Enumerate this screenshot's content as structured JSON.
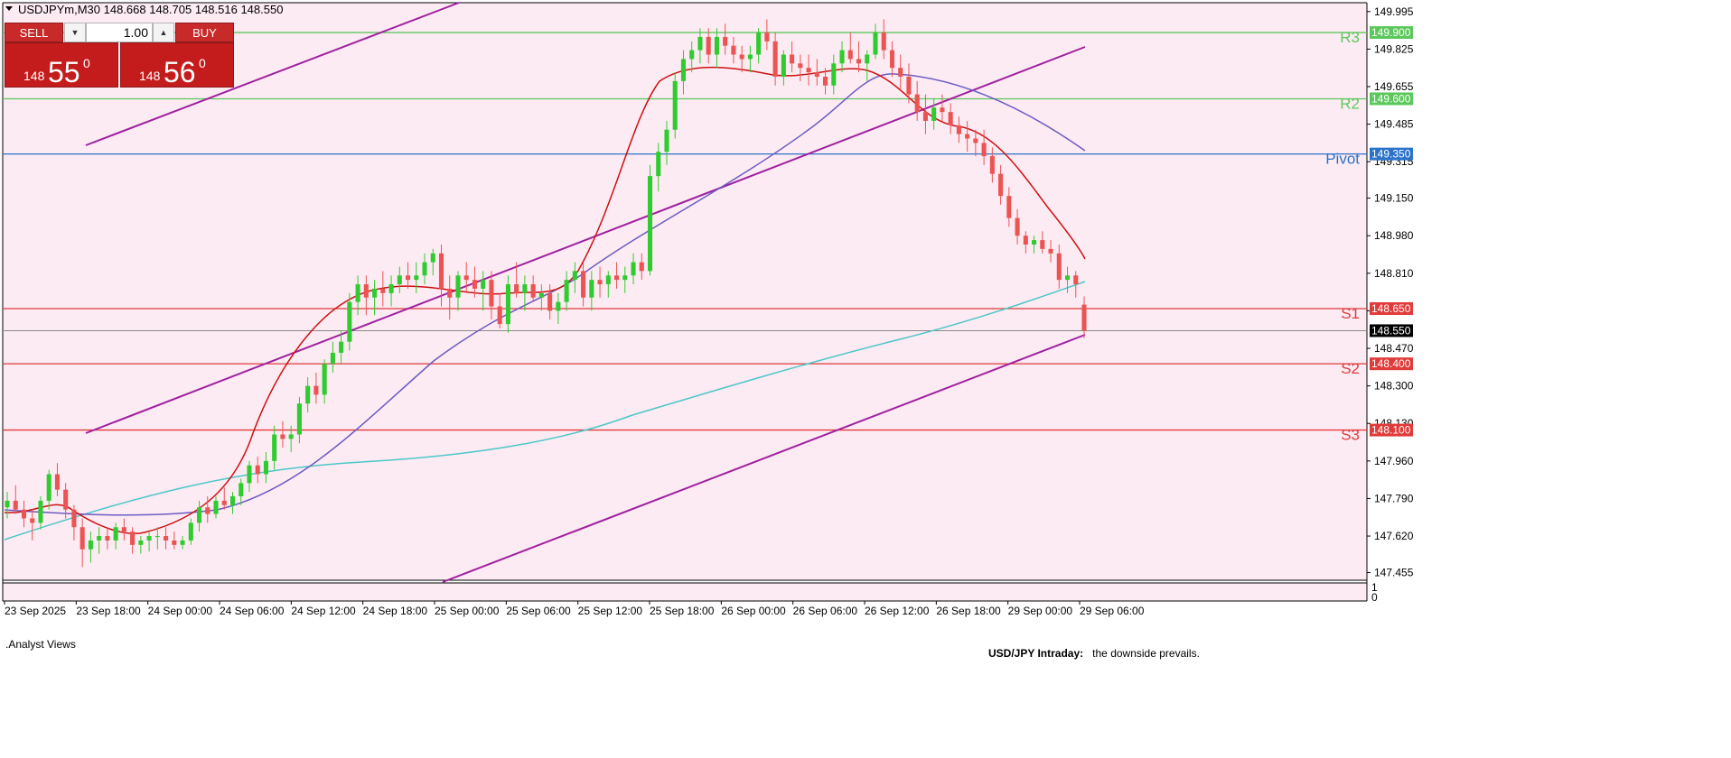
{
  "title": "USDJPYm,M30  148.668 148.705 148.516 148.550",
  "trade_panel": {
    "sell_label": "SELL",
    "buy_label": "BUY",
    "lot": "1.00",
    "sell_price_small": "148",
    "sell_price_big": "55",
    "sell_price_sup": "0",
    "buy_price_small": "148",
    "buy_price_big": "56",
    "buy_price_sup": "0"
  },
  "indicator_window": {
    "name": ".Analyst Views",
    "note_bold": "USD/JPY Intraday:",
    "note_text": "the downside prevails.",
    "scale_top": "1",
    "scale_bottom": "0"
  },
  "chart_data": {
    "type": "candlestick",
    "symbol": "USDJPYm",
    "timeframe": "M30",
    "ohlc": {
      "open": 148.668,
      "high": 148.705,
      "low": 148.516,
      "close": 148.55
    },
    "y_ticks": [
      "149.995",
      "149.825",
      "149.655",
      "149.485",
      "149.315",
      "149.150",
      "148.980",
      "148.810",
      "148.640",
      "148.470",
      "148.300",
      "148.130",
      "147.960",
      "147.790",
      "147.620",
      "147.455"
    ],
    "ylim": [
      147.42,
      150.035
    ],
    "x_labels": [
      "23 Sep 2025",
      "23 Sep 18:00",
      "24 Sep 00:00",
      "24 Sep 06:00",
      "24 Sep 12:00",
      "24 Sep 18:00",
      "25 Sep 00:00",
      "25 Sep 06:00",
      "25 Sep 12:00",
      "25 Sep 18:00",
      "26 Sep 00:00",
      "26 Sep 06:00",
      "26 Sep 12:00",
      "26 Sep 18:00",
      "29 Sep 00:00",
      "29 Sep 06:00"
    ],
    "levels": [
      {
        "name": "R3",
        "value": 149.9,
        "tag": "149.900",
        "color": "#5cc85c"
      },
      {
        "name": "R2",
        "value": 149.6,
        "tag": "149.600",
        "color": "#5cc85c"
      },
      {
        "name": "Pivot",
        "value": 149.35,
        "tag": "149.350",
        "color": "#2b72c9"
      },
      {
        "name": "S1",
        "value": 148.65,
        "tag": "148.650",
        "color": "#e03a3a"
      },
      {
        "name": "S2",
        "value": 148.4,
        "tag": "148.400",
        "color": "#e03a3a"
      },
      {
        "name": "S3",
        "value": 148.1,
        "tag": "148.100",
        "color": "#e03a3a"
      }
    ],
    "current_price": {
      "value": 148.55,
      "tag": "148.550"
    },
    "colors": {
      "bull": "#2ecc2e",
      "bear": "#ec5353",
      "ma_fast": "#cc1111",
      "ma_mid": "#6b5bc2",
      "ma_slow": "#4cc7c7",
      "channel": "#a020a0",
      "background": "#fdebf3"
    },
    "candles": [
      [
        147.75,
        147.82,
        147.7,
        147.78
      ],
      [
        147.78,
        147.85,
        147.72,
        147.74
      ],
      [
        147.74,
        147.78,
        147.66,
        147.7
      ],
      [
        147.7,
        147.74,
        147.6,
        147.68
      ],
      [
        147.68,
        147.8,
        147.65,
        147.78
      ],
      [
        147.78,
        147.92,
        147.74,
        147.9
      ],
      [
        147.9,
        147.95,
        147.8,
        147.83
      ],
      [
        147.83,
        147.86,
        147.7,
        147.74
      ],
      [
        147.74,
        147.76,
        147.6,
        147.66
      ],
      [
        147.66,
        147.7,
        147.48,
        147.56
      ],
      [
        147.56,
        147.64,
        147.5,
        147.6
      ],
      [
        147.6,
        147.66,
        147.54,
        147.62
      ],
      [
        147.62,
        147.66,
        147.56,
        147.6
      ],
      [
        147.6,
        147.68,
        147.56,
        147.66
      ],
      [
        147.66,
        147.7,
        147.6,
        147.64
      ],
      [
        147.64,
        147.66,
        147.54,
        147.58
      ],
      [
        147.58,
        147.62,
        147.54,
        147.6
      ],
      [
        147.6,
        147.64,
        147.55,
        147.62
      ],
      [
        147.62,
        147.66,
        147.56,
        147.62
      ],
      [
        147.62,
        147.66,
        147.56,
        147.6
      ],
      [
        147.6,
        147.64,
        147.56,
        147.58
      ],
      [
        147.58,
        147.62,
        147.56,
        147.6
      ],
      [
        147.6,
        147.7,
        147.58,
        147.68
      ],
      [
        147.68,
        147.78,
        147.64,
        147.75
      ],
      [
        147.75,
        147.8,
        147.68,
        147.72
      ],
      [
        147.72,
        147.8,
        147.7,
        147.78
      ],
      [
        147.78,
        147.84,
        147.74,
        147.76
      ],
      [
        147.76,
        147.82,
        147.72,
        147.8
      ],
      [
        147.8,
        147.88,
        147.76,
        147.86
      ],
      [
        147.86,
        147.96,
        147.82,
        147.94
      ],
      [
        147.94,
        147.98,
        147.86,
        147.9
      ],
      [
        147.9,
        148.0,
        147.86,
        147.96
      ],
      [
        147.96,
        148.12,
        147.92,
        148.08
      ],
      [
        148.08,
        148.14,
        148.02,
        148.06
      ],
      [
        148.06,
        148.12,
        148.0,
        148.08
      ],
      [
        148.08,
        148.25,
        148.04,
        148.22
      ],
      [
        148.22,
        148.34,
        148.18,
        148.3
      ],
      [
        148.3,
        148.36,
        148.22,
        148.26
      ],
      [
        148.26,
        148.42,
        148.22,
        148.4
      ],
      [
        148.4,
        148.5,
        148.36,
        148.45
      ],
      [
        148.45,
        148.55,
        148.4,
        148.5
      ],
      [
        148.5,
        148.72,
        148.46,
        148.68
      ],
      [
        148.68,
        148.8,
        148.62,
        148.76
      ],
      [
        148.76,
        148.8,
        148.62,
        148.7
      ],
      [
        148.7,
        148.78,
        148.62,
        148.74
      ],
      [
        148.74,
        148.82,
        148.66,
        148.72
      ],
      [
        148.72,
        148.8,
        148.66,
        148.76
      ],
      [
        148.76,
        148.84,
        148.72,
        148.8
      ],
      [
        148.8,
        148.86,
        148.74,
        148.78
      ],
      [
        148.78,
        148.86,
        148.72,
        148.8
      ],
      [
        148.8,
        148.9,
        148.76,
        148.86
      ],
      [
        148.86,
        148.92,
        148.8,
        148.9
      ],
      [
        148.9,
        148.94,
        148.66,
        148.74
      ],
      [
        148.74,
        148.8,
        148.6,
        148.7
      ],
      [
        148.7,
        148.82,
        148.64,
        148.8
      ],
      [
        148.8,
        148.86,
        148.72,
        148.78
      ],
      [
        148.78,
        148.84,
        148.7,
        148.74
      ],
      [
        148.74,
        148.82,
        148.64,
        148.78
      ],
      [
        148.78,
        148.82,
        148.6,
        148.66
      ],
      [
        148.66,
        148.72,
        148.56,
        148.58
      ],
      [
        148.58,
        148.8,
        148.54,
        148.76
      ],
      [
        148.76,
        148.86,
        148.7,
        148.72
      ],
      [
        148.72,
        148.8,
        148.64,
        148.76
      ],
      [
        148.76,
        148.8,
        148.68,
        148.7
      ],
      [
        148.7,
        148.76,
        148.64,
        148.72
      ],
      [
        148.72,
        148.76,
        148.6,
        148.64
      ],
      [
        148.64,
        148.72,
        148.58,
        148.68
      ],
      [
        148.68,
        148.82,
        148.64,
        148.78
      ],
      [
        148.78,
        148.86,
        148.72,
        148.82
      ],
      [
        148.82,
        148.86,
        148.66,
        148.7
      ],
      [
        148.7,
        148.82,
        148.64,
        148.78
      ],
      [
        148.78,
        148.84,
        148.7,
        148.76
      ],
      [
        148.76,
        148.82,
        148.7,
        148.8
      ],
      [
        148.8,
        148.86,
        148.74,
        148.78
      ],
      [
        148.78,
        148.84,
        148.72,
        148.8
      ],
      [
        148.8,
        148.9,
        148.76,
        148.86
      ],
      [
        148.86,
        148.9,
        148.78,
        148.82
      ],
      [
        148.82,
        149.3,
        148.8,
        149.25
      ],
      [
        149.25,
        149.4,
        149.18,
        149.36
      ],
      [
        149.36,
        149.5,
        149.3,
        149.46
      ],
      [
        149.46,
        149.72,
        149.42,
        149.68
      ],
      [
        149.68,
        149.82,
        149.62,
        149.78
      ],
      [
        149.78,
        149.86,
        149.72,
        149.82
      ],
      [
        149.82,
        149.92,
        149.76,
        149.88
      ],
      [
        149.88,
        149.92,
        149.76,
        149.8
      ],
      [
        149.8,
        149.92,
        149.74,
        149.88
      ],
      [
        149.88,
        149.94,
        149.8,
        149.84
      ],
      [
        149.84,
        149.88,
        149.76,
        149.8
      ],
      [
        149.8,
        149.84,
        149.72,
        149.78
      ],
      [
        149.78,
        149.84,
        149.72,
        149.8
      ],
      [
        149.8,
        149.92,
        149.76,
        149.9
      ],
      [
        149.9,
        149.96,
        149.82,
        149.86
      ],
      [
        149.86,
        149.9,
        149.66,
        149.7
      ],
      [
        149.7,
        149.82,
        149.66,
        149.8
      ],
      [
        149.8,
        149.86,
        149.72,
        149.76
      ],
      [
        149.76,
        149.8,
        149.68,
        149.74
      ],
      [
        149.74,
        149.8,
        149.66,
        149.72
      ],
      [
        149.72,
        149.78,
        149.66,
        149.7
      ],
      [
        149.7,
        149.74,
        149.62,
        149.66
      ],
      [
        149.66,
        149.8,
        149.62,
        149.76
      ],
      [
        149.76,
        149.86,
        149.72,
        149.82
      ],
      [
        149.82,
        149.9,
        149.76,
        149.78
      ],
      [
        149.78,
        149.86,
        149.72,
        149.76
      ],
      [
        149.76,
        149.82,
        149.68,
        149.8
      ],
      [
        149.8,
        149.94,
        149.78,
        149.9
      ],
      [
        149.9,
        149.96,
        149.78,
        149.82
      ],
      [
        149.82,
        149.86,
        149.7,
        149.74
      ],
      [
        149.74,
        149.8,
        149.64,
        149.7
      ],
      [
        149.7,
        149.76,
        149.58,
        149.62
      ],
      [
        149.62,
        149.68,
        149.5,
        149.54
      ],
      [
        149.54,
        149.62,
        149.44,
        149.5
      ],
      [
        149.5,
        149.6,
        149.46,
        149.56
      ],
      [
        149.56,
        149.62,
        149.5,
        149.54
      ],
      [
        149.54,
        149.58,
        149.44,
        149.48
      ],
      [
        149.48,
        149.52,
        149.4,
        149.44
      ],
      [
        149.44,
        149.5,
        149.36,
        149.42
      ],
      [
        149.42,
        149.46,
        149.34,
        149.4
      ],
      [
        149.4,
        149.46,
        149.3,
        149.34
      ],
      [
        149.34,
        149.38,
        149.22,
        149.26
      ],
      [
        149.26,
        149.3,
        149.12,
        149.16
      ],
      [
        149.16,
        149.2,
        149.02,
        149.06
      ],
      [
        149.06,
        149.1,
        148.94,
        148.98
      ],
      [
        148.98,
        149.0,
        148.9,
        148.94
      ],
      [
        148.94,
        148.98,
        148.9,
        148.96
      ],
      [
        148.96,
        149.0,
        148.9,
        148.92
      ],
      [
        148.92,
        148.96,
        148.86,
        148.9
      ],
      [
        148.9,
        148.94,
        148.74,
        148.78
      ],
      [
        148.78,
        148.84,
        148.72,
        148.8
      ],
      [
        148.8,
        148.82,
        148.7,
        148.76
      ],
      [
        148.668,
        148.705,
        148.516,
        148.55
      ]
    ]
  }
}
